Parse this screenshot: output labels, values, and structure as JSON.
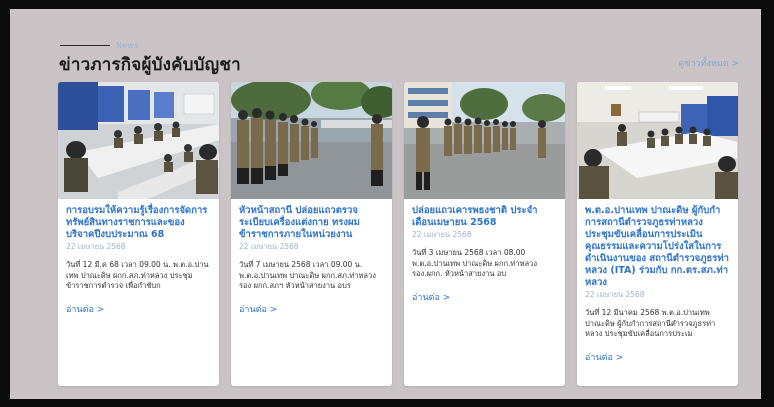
{
  "section": {
    "eyebrow": "News",
    "title": "ข่าวภารกิจผู้บังคับบัญชา",
    "view_all": "ดูข่าวทั้งหมด >"
  },
  "cards": [
    {
      "title": "การอบรมให้ความรู้เรื่องการจัดการทรัพย์สินทางราชการและของบริจาคปีงบประมาณ 68",
      "date": "22 เมษายน 2568",
      "excerpt": "วันที่ 12 มี.ค 68 เวลา 09.00 น. พ.ต.อ.ปานเทพ ปาณะดิษ ผกก.สภ.ท่าหลวง ประชุมข้าราชการตำรวจ เพื่อกำชับก",
      "more": "อ่านต่อ >"
    },
    {
      "title": "หัวหน้าสถานี ปล่อยแถวตรวจระเบียบเครื่องแต่งกาย ทรงผมข้าราชการภายในหน่วยงาน",
      "date": "22 เมษายน 2568",
      "excerpt": "วันที่ 7 เมษายน 2568 เวลา 09.00 น. พ.ต.อ.ปานเทพ ปาณะดิษ ผกก.สภ.ท่าหลวง รอง ผกก.สภฯ หัวหน้าสายงาน อบร",
      "more": "อ่านต่อ >"
    },
    {
      "title": "ปล่อยแถวเคารพธงชาติ ประจำเดือนเมษายน 2568",
      "date": "22 เมษายน 2568",
      "excerpt": "วันที่ 3 เมษายน 2568 เวลา 08.00 พ.ต.อ.ปานเทพ ปาณะดิษ ผกก.ท่าหลวง รอง.ผกก. หัวหน้าสายงาน อบ",
      "more": "อ่านต่อ >"
    },
    {
      "title": "พ.ต.อ.ปานเทพ ปาณะดิษ ผู้กับกำการสถานีตำรวจภูธรท่าหลวง ประชุมขับเคลื่อนการประเมินคุณธรรมและความโปร่งใสในการดำเนินงานของ สถานีตำรวจภูธรท่าหลวง (ITA) ร่วมกับ กก.ตร.สภ.ท่าหลวง",
      "date": "22 เมษายน 2568",
      "excerpt": "วันที่ 12 มีนาคม 2568 พ.ต.อ.ปานเทพ ปาณะดิษ ผู้กับกำการสถานีตำรวจภูธรท่าหลวง ประชุมขับเคลื่อนการประเม",
      "more": "อ่านต่อ >"
    }
  ]
}
